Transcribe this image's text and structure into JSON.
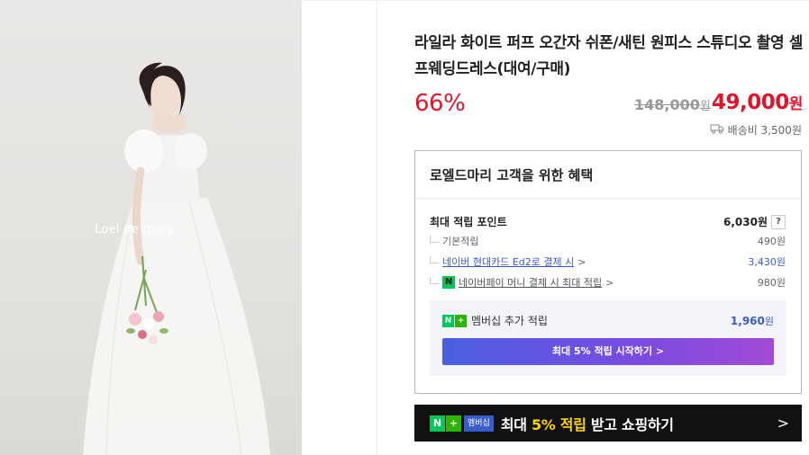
{
  "product": {
    "photo_watermark": "Loel de mary",
    "title": "라일라 화이트 퍼프 오간자 쉬폰/새틴 원피스 스튜디오 촬영 셀프웨딩드레스(대여/구매)",
    "discount": "66%",
    "original_price": "148,000",
    "original_price_unit": "원",
    "sale_price": "49,000",
    "sale_price_unit": "원",
    "shipping": "배송비 3,500원"
  },
  "benefit": {
    "heading": "로엘드마리 고객을 위한 혜택",
    "max_points_label": "최대 적립 포인트",
    "max_points_value": "6,030원",
    "help": "?",
    "rows": [
      {
        "label": "기본적립",
        "value": "490원"
      },
      {
        "label": "네이버 현대카드 Ed2로 결제 시",
        "chevron": ">",
        "value": "3,430원"
      },
      {
        "label": "네이버페이 머니 결제 시 최대 적립",
        "chevron": ">",
        "value": "980원",
        "icon": "N"
      }
    ],
    "member": {
      "badge_n": "N",
      "badge_plus": "+",
      "label": "멤버십 추가 적립",
      "value": "1,960",
      "unit": "원",
      "button": "최대 5% 적립 시작하기 >"
    }
  },
  "banner": {
    "badge_n": "N",
    "badge_plus": "+",
    "badge_text": "멤버십",
    "text_pre": "최대 ",
    "text_highlight": "5% 적립",
    "text_post": " 받고 쇼핑하기",
    "chevron": ">"
  },
  "colors": {
    "accent_red": "#e0142a",
    "link_blue": "#3a5bcc",
    "naver_green": "#03c75a"
  }
}
